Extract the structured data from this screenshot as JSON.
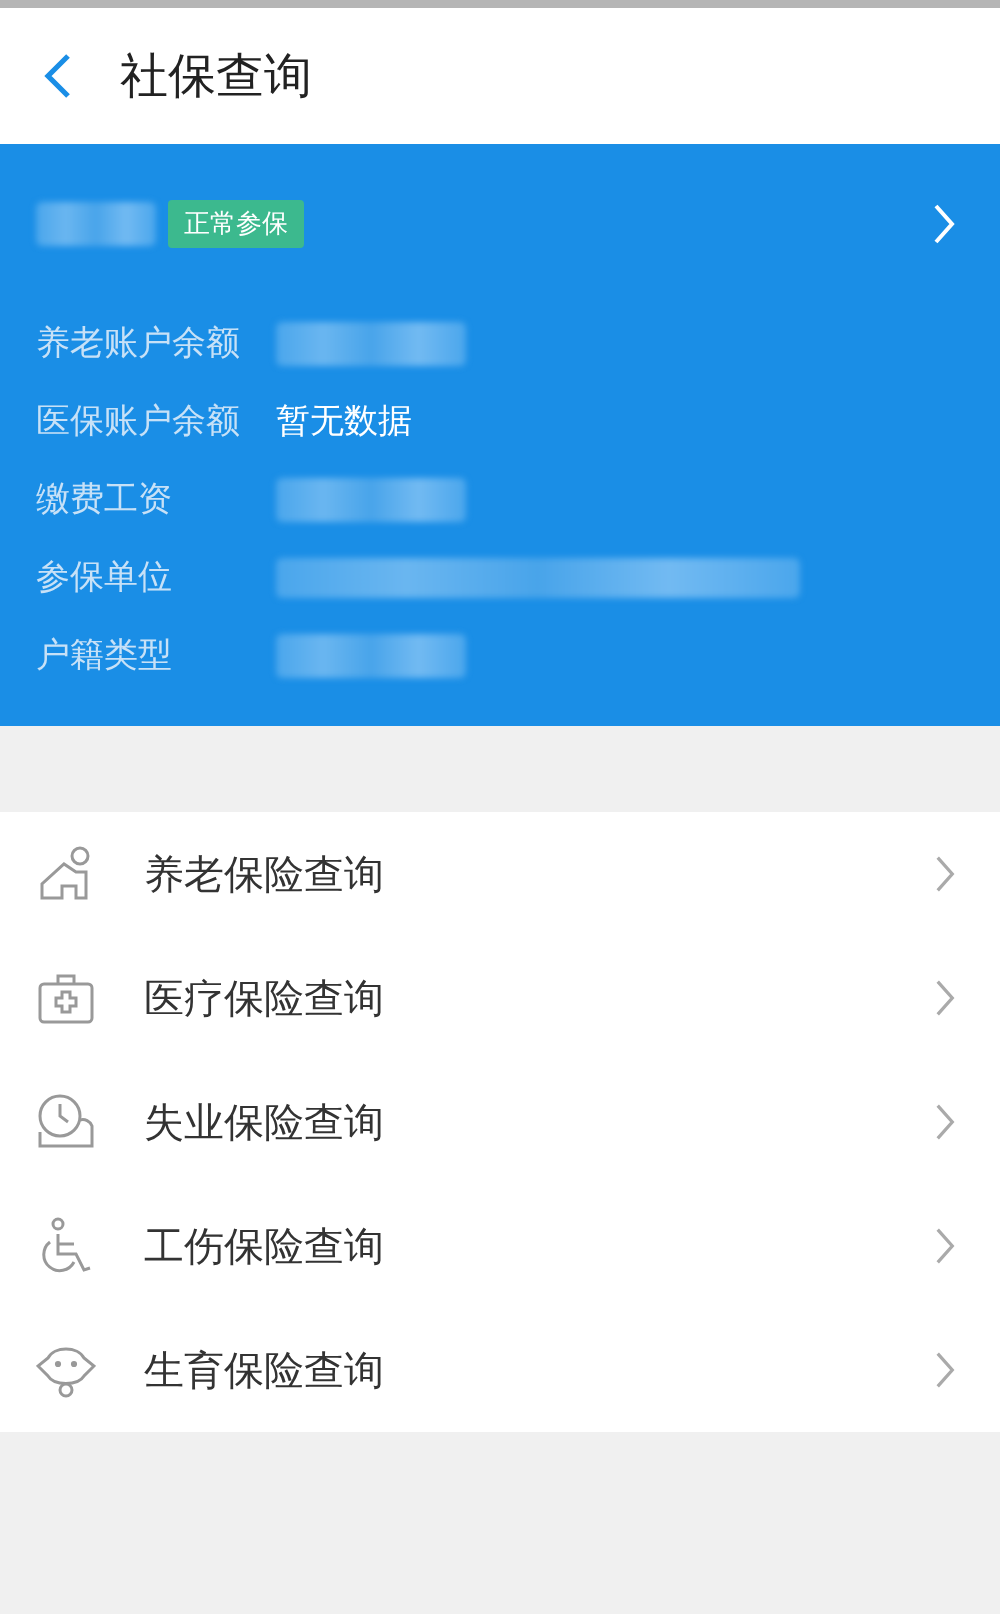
{
  "header": {
    "title": "社保查询"
  },
  "summary": {
    "name": {
      "kind": "blurred"
    },
    "status_badge": "正常参保",
    "fields": [
      {
        "label": "养老账户余额",
        "kind": "blurred"
      },
      {
        "label": "医保账户余额",
        "kind": "text",
        "value": "暂无数据"
      },
      {
        "label": "缴费工资",
        "kind": "blurred"
      },
      {
        "label": "参保单位",
        "kind": "blurred_long"
      },
      {
        "label": "户籍类型",
        "kind": "blurred"
      }
    ]
  },
  "menu": [
    {
      "label": "养老保险查询",
      "kind": "elderly"
    },
    {
      "label": "医疗保险查询",
      "kind": "medical"
    },
    {
      "label": "失业保险查询",
      "kind": "unemployment"
    },
    {
      "label": "工伤保险查询",
      "kind": "injury"
    },
    {
      "label": "生育保险查询",
      "kind": "maternity"
    }
  ]
}
